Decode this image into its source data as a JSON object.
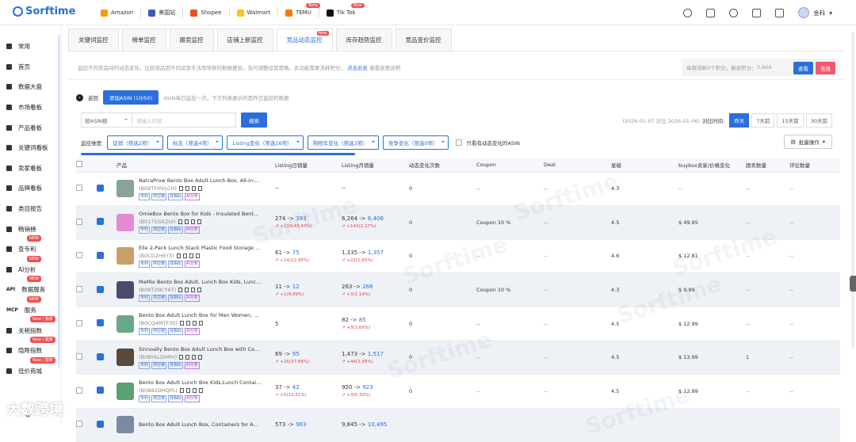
{
  "brand": "Sorftime",
  "platforms": [
    {
      "label": "Amazon",
      "color": "#f0a000",
      "badge": ""
    },
    {
      "label": "美国站",
      "color": "#3b5bb5",
      "badge": ""
    },
    {
      "label": "Shopee",
      "color": "#ee4d2d",
      "badge": ""
    },
    {
      "label": "Walmart",
      "color": "#ffc220",
      "badge": ""
    },
    {
      "label": "TEMU",
      "color": "#f57c00",
      "badge": "Beta"
    },
    {
      "label": "Tik Tok",
      "color": "#111111",
      "badge": "New"
    }
  ],
  "user": {
    "name": "金科"
  },
  "sidebar": [
    {
      "label": "常用",
      "badge": ""
    },
    {
      "label": "首页",
      "badge": ""
    },
    {
      "label": "数据大盘",
      "badge": ""
    },
    {
      "label": "市场看板",
      "badge": ""
    },
    {
      "label": "产品看板",
      "badge": ""
    },
    {
      "label": "关键词看板",
      "badge": ""
    },
    {
      "label": "卖家看板",
      "badge": ""
    },
    {
      "label": "品牌看板",
      "badge": ""
    },
    {
      "label": "类目报告",
      "badge": ""
    },
    {
      "label": "畅销榜",
      "badge": ""
    },
    {
      "label": "查专利",
      "badge": "NEW"
    },
    {
      "label": "AI分析",
      "badge": "NEW"
    },
    {
      "label": "数据服务",
      "prefix": "API",
      "badge": "NEW"
    },
    {
      "label": "服务",
      "prefix": "MCP",
      "badge": "NEW"
    },
    {
      "label": "关税指数",
      "badge": "New | 独家"
    },
    {
      "label": "隐降指数",
      "badge": "New | 独家"
    },
    {
      "label": "低价商城",
      "badge": "New | 独家"
    }
  ],
  "tabs": [
    {
      "label": "关键词监控",
      "active": false,
      "new": ""
    },
    {
      "label": "榜单监控",
      "active": false,
      "new": ""
    },
    {
      "label": "跟卖监控",
      "active": false,
      "new": ""
    },
    {
      "label": "店铺上新监控",
      "active": false,
      "new": ""
    },
    {
      "label": "竞品动态监控",
      "active": true,
      "new": "New"
    },
    {
      "label": "库存趋势监控",
      "active": false,
      "new": ""
    },
    {
      "label": "竞品变价监控",
      "active": false,
      "new": ""
    }
  ],
  "notice": {
    "text": "监控不同竞品间的动态变化，比较竞品因不同运营手法而导致的数据差异，及时调整运营策略。此功能需要消耗积分，",
    "link": "点击此处",
    "tail": "查看收费说明"
  },
  "points": {
    "text": "每周消耗0个积分，剩余积分：",
    "value": "3,664",
    "view": "查看",
    "recharge": "充值"
  },
  "back": "返回",
  "add_button": "添加ASIN (10/50)",
  "add_hint": "ASIN每日监控一次，下方列表展示的是昨日监控的数据",
  "search": {
    "select": "按ASIN搜",
    "placeholder": "请输入内容",
    "button": "搜索"
  },
  "date": {
    "range": "(2026-01-07 对比 2026-01-06)",
    "label": "对比时间:",
    "options": [
      {
        "label": "昨天",
        "on": true
      },
      {
        "label": "7天前",
        "on": false
      },
      {
        "label": "15天前",
        "on": false
      },
      {
        "label": "30天前",
        "on": false
      }
    ]
  },
  "filters": {
    "label": "监控维度:",
    "items": [
      "促销（筛选2项）",
      "标志（筛选4项）",
      "Listing变化（筛选16项）",
      "购物车变化（筛选3项）",
      "竞争变化（筛选0项）"
    ],
    "only": "只看有动态变化的ASIN",
    "batch": "批量操作"
  },
  "columns": [
    "产品",
    "Listing日销量",
    "Listing月销量",
    "动态变化次数",
    "Coupon",
    "Deal",
    "星级",
    "buybox卖家/价格变化",
    "跟卖数量",
    "评论数量"
  ],
  "tag_labels": [
    "专利",
    "供应链",
    "找相似",
    "AI分析"
  ],
  "rows": [
    {
      "title": "NatraProw Bento Box Adult Lunch Box, All-in-On...",
      "asin": "(B09TFHVLCH)",
      "daily": {
        "a": "--",
        "b": "",
        "chg": ""
      },
      "monthly": {
        "a": "--",
        "b": "",
        "chg": ""
      },
      "changes": "0",
      "coupon": "--",
      "deal": "--",
      "star": "4.3",
      "buybox": "--",
      "follow": "--",
      "reviews": "--",
      "thumb": "#8aa39a"
    },
    {
      "title": "OmieBox Bento Box for Kids - Insulated Bento L...",
      "asin": "(B017SGKZUI)",
      "daily": {
        "a": "274",
        "b": "393",
        "chg": "+119(43.43%)"
      },
      "monthly": {
        "a": "6,264",
        "b": "6,406",
        "chg": "+142(2.27%)"
      },
      "changes": "0",
      "coupon": "Coupon 10 %",
      "deal": "--",
      "star": "4.5",
      "buybox": "$ 49.95",
      "follow": "--",
      "reviews": "--",
      "thumb": "#e58bd3"
    },
    {
      "title": "Elle 2-Pack Lunch Stack Plastic Food Storage C...",
      "asin": "(B0CG2H6Y3)",
      "daily": {
        "a": "61",
        "b": "75",
        "chg": "+14(22.95%)"
      },
      "monthly": {
        "a": "1,335",
        "b": "1,357",
        "chg": "+22(1.65%)"
      },
      "changes": "0",
      "coupon": "--",
      "deal": "--",
      "star": "4.6",
      "buybox": "$ 12.81",
      "follow": "--",
      "reviews": "--",
      "thumb": "#c8a06a"
    },
    {
      "title": "MaMix Bento Box Adult, Lunch Box Kids, Lunch ...",
      "asin": "(B09T2NCY6T)",
      "daily": {
        "a": "11",
        "b": "12",
        "chg": "+1(9.09%)"
      },
      "monthly": {
        "a": "263",
        "b": "266",
        "chg": "+3(1.14%)"
      },
      "changes": "0",
      "coupon": "Coupon 10 %",
      "deal": "--",
      "star": "4.3",
      "buybox": "$ 9.99",
      "follow": "--",
      "reviews": "--",
      "thumb": "#4a4a6a"
    },
    {
      "title": "Bento Box Adult Lunch Box for Men Women, Be...",
      "asin": "(B0CQ4MTF3S)",
      "daily": {
        "a": "5",
        "b": "",
        "chg": ""
      },
      "monthly": {
        "a": "82",
        "b": "85",
        "chg": "+3(3.66%)"
      },
      "changes": "0",
      "coupon": "--",
      "deal": "--",
      "star": "4.5",
      "buybox": "$ 12.99",
      "follow": "--",
      "reviews": "--",
      "thumb": "#6aa88a"
    },
    {
      "title": "Sinnoally Bento Box Adult Lunch Box with Comp...",
      "asin": "(B0BY6LDHPH)",
      "daily": {
        "a": "69",
        "b": "95",
        "chg": "+26(37.68%)"
      },
      "monthly": {
        "a": "1,473",
        "b": "1,517",
        "chg": "+44(2.99%)"
      },
      "changes": "0",
      "coupon": "--",
      "deal": "--",
      "star": "4.5",
      "buybox": "$ 13.99",
      "follow": "1",
      "reviews": "--",
      "thumb": "#5a4a3a"
    },
    {
      "title": "Bento Box Adult Lunch Box Kids,Lunch Contain...",
      "asin": "(B0B82DHQPL)",
      "daily": {
        "a": "37",
        "b": "42",
        "chg": "+5(13.51%)"
      },
      "monthly": {
        "a": "920",
        "b": "923",
        "chg": "+3(0.33%)"
      },
      "changes": "0",
      "coupon": "--",
      "deal": "--",
      "star": "4.5",
      "buybox": "$ 12.99",
      "follow": "--",
      "reviews": "--",
      "thumb": "#5aa070"
    },
    {
      "title": "Bento Box Adult Lunch Box, Containers for Adult...",
      "asin": "",
      "daily": {
        "a": "573",
        "b": "983",
        "chg": ""
      },
      "monthly": {
        "a": "9,845",
        "b": "10,495",
        "chg": ""
      },
      "changes": "",
      "coupon": "",
      "deal": "",
      "star": "",
      "buybox": "",
      "follow": "",
      "reviews": "",
      "thumb": "#7a8aa0"
    }
  ],
  "watermark_text": "Sorftime",
  "footer_mark": "大数跨境"
}
